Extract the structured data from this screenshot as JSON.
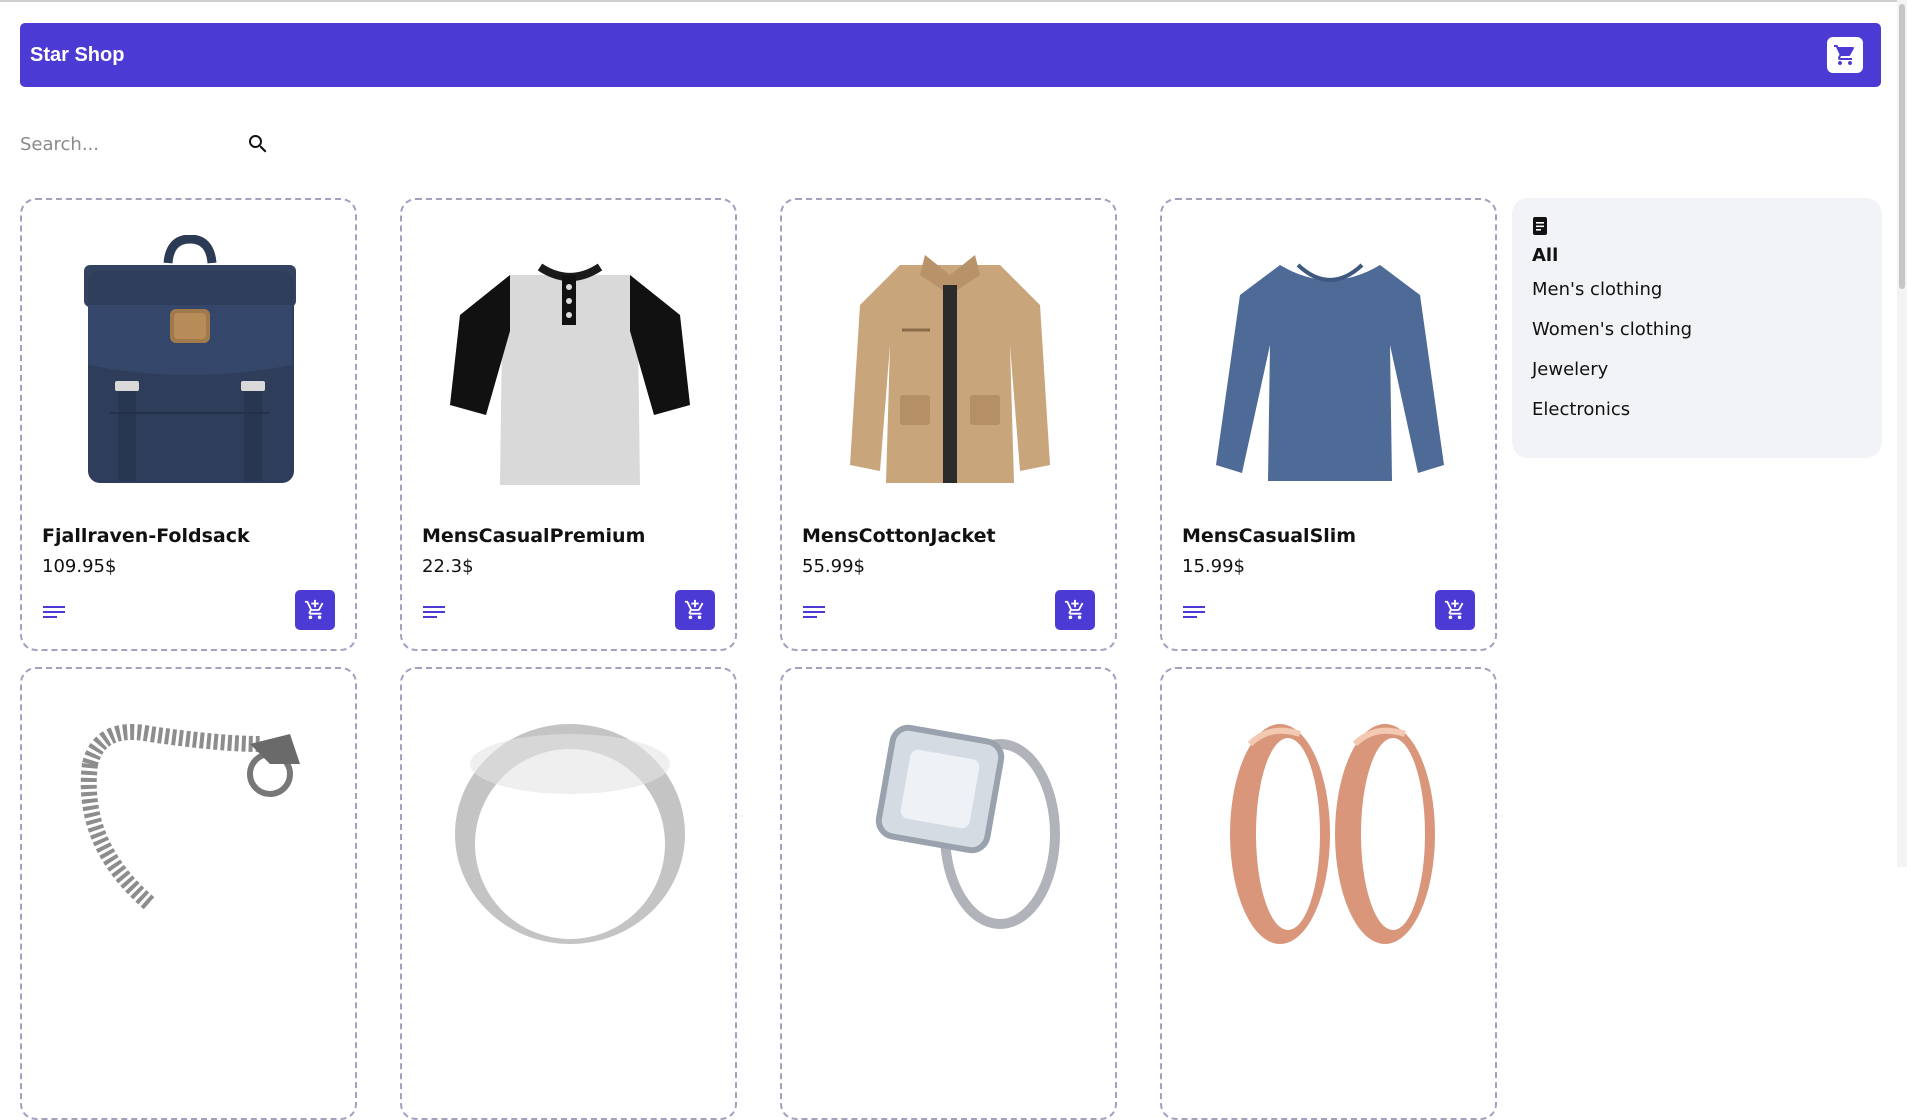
{
  "header": {
    "brand": "Star Shop",
    "cart_icon": "cart-icon",
    "color": "#4b3ad4"
  },
  "search": {
    "placeholder": "Search...",
    "value": ""
  },
  "products": [
    {
      "title": "Fjallraven-Foldsack",
      "price": "109.95$",
      "image": "backpack"
    },
    {
      "title": "MensCasualPremium",
      "price": "22.3$",
      "image": "raglan-tshirt"
    },
    {
      "title": "MensCottonJacket",
      "price": "55.99$",
      "image": "jacket"
    },
    {
      "title": "MensCasualSlim",
      "price": "15.99$",
      "image": "longsleeve"
    },
    {
      "title": "",
      "price": "",
      "image": "dragon-bracelet"
    },
    {
      "title": "",
      "price": "",
      "image": "silver-ring"
    },
    {
      "title": "",
      "price": "",
      "image": "diamond-ring"
    },
    {
      "title": "",
      "price": "",
      "image": "rose-gold-rings"
    }
  ],
  "categories": {
    "icon": "document-icon",
    "items": [
      "All",
      "Men's clothing",
      "Women's clothing",
      "Jewelery",
      "Electronics"
    ],
    "active": "All"
  }
}
